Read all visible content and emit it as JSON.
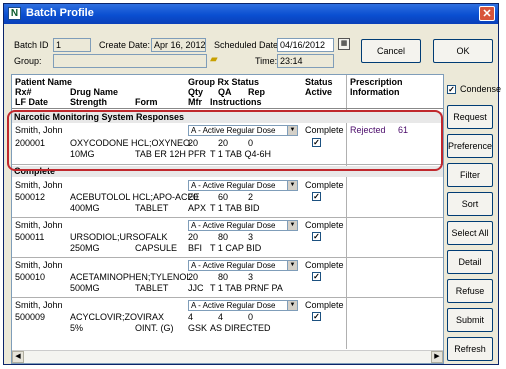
{
  "window": {
    "title": "Batch Profile",
    "app_icon": "N"
  },
  "header": {
    "batch_id_label": "Batch ID",
    "batch_id_value": "1",
    "create_date_label": "Create Date:",
    "create_date_value": "Apr 16, 2012",
    "scheduled_date_label": "Scheduled Date:",
    "scheduled_date_value": "04/16/2012",
    "group_label": "Group:",
    "group_value": "",
    "time_label": "Time:",
    "time_value": "23:14",
    "cancel_label": "Cancel",
    "ok_label": "OK"
  },
  "columns": {
    "patient_name": "Patient Name",
    "rx_num": "Rx#",
    "lf_date": "LF Date",
    "drug_name": "Drug Name",
    "strength": "Strength",
    "form": "Form",
    "group_rx_status": "Group Rx Status",
    "qty": "Qty",
    "qa": "QA",
    "rep": "Rep",
    "mfr": "Mfr",
    "instructions": "Instructions",
    "status": "Status",
    "active": "Active",
    "prescription": "Prescription",
    "information": "Information"
  },
  "sections": [
    {
      "title": "Narcotic Monitoring System Responses"
    },
    {
      "title": "Complete"
    }
  ],
  "rows": [
    {
      "patient": "Smith, John",
      "rx": "200001",
      "drug": "OXYCODONE HCL;OXYNEO",
      "strength": "10MG",
      "form": "TAB ER 12H",
      "rx_status": "A - Active Regular Dose",
      "qty": "20",
      "qa": "20",
      "rep": "0",
      "mfr": "PFR",
      "instructions": "T 1 TAB Q4-6H",
      "status": "Complete",
      "active": true,
      "info_status": "Rejected",
      "info_code": "61"
    },
    {
      "patient": "Smith, John",
      "rx": "500012",
      "drug": "ACEBUTOLOL HCL;APO-ACEE",
      "strength": "400MG",
      "form": "TABLET",
      "rx_status": "A - Active Regular Dose",
      "qty": "20",
      "qa": "60",
      "rep": "2",
      "mfr": "APX",
      "instructions": "T 1 TAB BID",
      "status": "Complete",
      "active": true
    },
    {
      "patient": "Smith, John",
      "rx": "500011",
      "drug": "URSODIOL;URSOFALK",
      "strength": "250MG",
      "form": "CAPSULE",
      "rx_status": "A - Active Regular Dose",
      "qty": "20",
      "qa": "80",
      "rep": "3",
      "mfr": "BFI",
      "instructions": "T 1 CAP BID",
      "status": "Complete",
      "active": true
    },
    {
      "patient": "Smith, John",
      "rx": "500010",
      "drug": "ACETAMINOPHEN;TYLENOL",
      "strength": "500MG",
      "form": "TABLET",
      "rx_status": "A - Active Regular Dose",
      "qty": "20",
      "qa": "80",
      "rep": "3",
      "mfr": "JJC",
      "instructions": "T 1 TAB PRNF PA",
      "status": "Complete",
      "active": true
    },
    {
      "patient": "Smith, John",
      "rx": "500009",
      "drug": "ACYCLOVIR;ZOVIRAX",
      "strength": "5%",
      "form": "OINT. (G)",
      "rx_status": "A - Active Regular Dose",
      "qty": "4",
      "qa": "4",
      "rep": "0",
      "mfr": "GSK",
      "instructions": "AS DIRECTED",
      "status": "Complete",
      "active": true
    }
  ],
  "side": {
    "condense_label": "Condense",
    "condense_checked": true,
    "buttons": [
      "Request",
      "Preference",
      "Filter",
      "Sort",
      "Select All",
      "Detail",
      "Refuse",
      "Submit",
      "Refresh"
    ]
  },
  "colors": {
    "highlight": "#c0282d",
    "titlebar": "#0a4fd1"
  }
}
